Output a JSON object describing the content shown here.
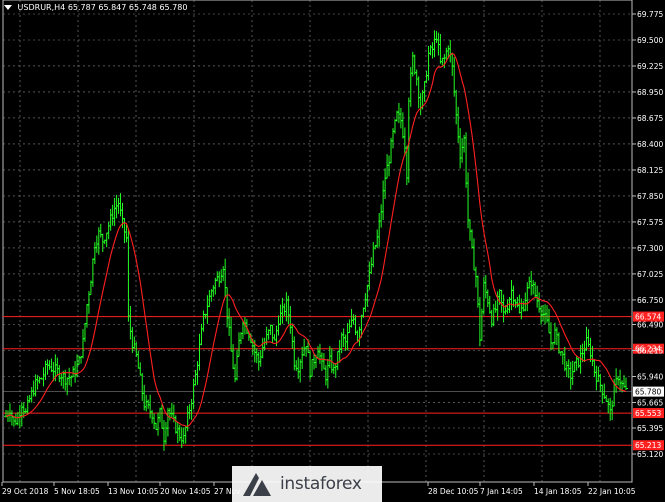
{
  "header": {
    "symbol": "USDRUR,H4",
    "open": "65.787",
    "high": "65.847",
    "low": "65.748",
    "close": "65.780"
  },
  "watermark": "instaforex",
  "colors": {
    "background": "#000000",
    "grid": "#8a8a8a",
    "bar": "#22ff22",
    "ma": "#ff2020",
    "level": "#ff2020",
    "axis_text": "#ffffff"
  },
  "chart_data": {
    "type": "ohlc",
    "grid": true,
    "ylim": [
      65.12,
      69.86
    ],
    "y_ticks": [
      "69.775",
      "69.500",
      "69.225",
      "68.950",
      "68.675",
      "68.400",
      "68.125",
      "67.850",
      "67.575",
      "67.300",
      "67.025",
      "66.750",
      "66.490",
      "66.215",
      "65.940",
      "65.665",
      "65.395",
      "65.120"
    ],
    "x_ticks": [
      "29 Oct 2018",
      "5 Nov 18:05",
      "13 Nov 10:05",
      "20 Nov 14:05",
      "27 Nov",
      "28 Dec 10:05",
      "7 Jan 14:05",
      "14 Jan 18:05",
      "22 Jan 10:05"
    ],
    "levels": [
      {
        "value": 66.574,
        "label": "66.574"
      },
      {
        "value": 66.234,
        "label": "66.234"
      },
      {
        "value": 65.553,
        "label": "65.553"
      },
      {
        "value": 65.213,
        "label": "65.213"
      }
    ],
    "current_price": {
      "value": 65.78,
      "label": "65.780"
    },
    "close_points": [
      [
        0,
        65.52
      ],
      [
        4,
        65.6
      ],
      [
        8,
        65.45
      ],
      [
        12,
        65.5
      ],
      [
        16,
        65.66
      ],
      [
        20,
        65.55
      ],
      [
        24,
        65.7
      ],
      [
        30,
        65.86
      ],
      [
        36,
        65.92
      ],
      [
        42,
        66.06
      ],
      [
        48,
        66.02
      ],
      [
        54,
        65.98
      ],
      [
        60,
        65.92
      ],
      [
        66,
        65.94
      ],
      [
        70,
        66.0
      ],
      [
        74,
        66.1
      ],
      [
        78,
        66.3
      ],
      [
        82,
        66.7
      ],
      [
        86,
        66.98
      ],
      [
        90,
        67.35
      ],
      [
        94,
        67.45
      ],
      [
        98,
        67.38
      ],
      [
        102,
        67.48
      ],
      [
        106,
        67.6
      ],
      [
        110,
        67.72
      ],
      [
        114,
        67.78
      ],
      [
        118,
        67.55
      ],
      [
        122,
        67.4
      ],
      [
        124,
        66.55
      ],
      [
        128,
        66.3
      ],
      [
        132,
        66.15
      ],
      [
        136,
        65.9
      ],
      [
        140,
        65.65
      ],
      [
        144,
        65.6
      ],
      [
        148,
        65.55
      ],
      [
        152,
        65.4
      ],
      [
        156,
        65.55
      ],
      [
        160,
        65.3
      ],
      [
        164,
        65.6
      ],
      [
        168,
        65.5
      ],
      [
        172,
        65.4
      ],
      [
        176,
        65.32
      ],
      [
        180,
        65.28
      ],
      [
        184,
        65.5
      ],
      [
        188,
        65.7
      ],
      [
        192,
        65.95
      ],
      [
        196,
        66.25
      ],
      [
        200,
        66.55
      ],
      [
        204,
        66.7
      ],
      [
        208,
        66.85
      ],
      [
        212,
        66.95
      ],
      [
        216,
        67.0
      ],
      [
        220,
        67.12
      ],
      [
        224,
        66.6
      ],
      [
        228,
        66.2
      ],
      [
        232,
        65.9
      ],
      [
        236,
        66.3
      ],
      [
        240,
        66.55
      ],
      [
        244,
        66.45
      ],
      [
        248,
        66.35
      ],
      [
        252,
        66.2
      ],
      [
        256,
        66.1
      ],
      [
        260,
        66.25
      ],
      [
        264,
        66.35
      ],
      [
        268,
        66.45
      ],
      [
        272,
        66.3
      ],
      [
        276,
        66.55
      ],
      [
        280,
        66.62
      ],
      [
        284,
        66.7
      ],
      [
        288,
        66.5
      ],
      [
        292,
        66.1
      ],
      [
        296,
        66.05
      ],
      [
        300,
        66.2
      ],
      [
        304,
        66.3
      ],
      [
        308,
        66.0
      ],
      [
        312,
        66.12
      ],
      [
        316,
        66.25
      ],
      [
        320,
        66.05
      ],
      [
        324,
        65.95
      ],
      [
        328,
        66.1
      ],
      [
        332,
        66.0
      ],
      [
        336,
        66.15
      ],
      [
        340,
        66.35
      ],
      [
        344,
        66.3
      ],
      [
        348,
        66.45
      ],
      [
        352,
        66.55
      ],
      [
        356,
        66.35
      ],
      [
        360,
        66.6
      ],
      [
        364,
        66.8
      ],
      [
        368,
        67.0
      ],
      [
        372,
        67.25
      ],
      [
        376,
        67.4
      ],
      [
        380,
        67.7
      ],
      [
        384,
        68.05
      ],
      [
        388,
        68.25
      ],
      [
        392,
        68.5
      ],
      [
        396,
        68.7
      ],
      [
        400,
        68.65
      ],
      [
        404,
        68.4
      ],
      [
        406,
        68.1
      ],
      [
        408,
        68.9
      ],
      [
        412,
        69.3
      ],
      [
        416,
        69.1
      ],
      [
        420,
        68.8
      ],
      [
        424,
        69.0
      ],
      [
        428,
        69.35
      ],
      [
        432,
        69.4
      ],
      [
        436,
        69.55
      ],
      [
        440,
        69.25
      ],
      [
        444,
        69.3
      ],
      [
        448,
        69.45
      ],
      [
        452,
        69.2
      ],
      [
        456,
        68.7
      ],
      [
        460,
        68.3
      ],
      [
        464,
        68.45
      ],
      [
        468,
        67.6
      ],
      [
        472,
        67.25
      ],
      [
        476,
        67.0
      ],
      [
        480,
        66.35
      ],
      [
        484,
        66.9
      ],
      [
        488,
        66.75
      ],
      [
        492,
        66.55
      ],
      [
        496,
        66.65
      ],
      [
        500,
        66.8
      ],
      [
        504,
        66.6
      ],
      [
        508,
        66.7
      ],
      [
        512,
        66.85
      ],
      [
        516,
        66.75
      ],
      [
        520,
        66.6
      ],
      [
        524,
        66.7
      ],
      [
        528,
        66.85
      ],
      [
        532,
        66.95
      ],
      [
        536,
        66.8
      ],
      [
        540,
        66.7
      ],
      [
        544,
        66.6
      ],
      [
        548,
        66.5
      ],
      [
        552,
        66.3
      ],
      [
        556,
        66.4
      ],
      [
        560,
        66.25
      ],
      [
        564,
        66.15
      ],
      [
        568,
        66.0
      ],
      [
        572,
        65.95
      ],
      [
        576,
        66.05
      ],
      [
        580,
        66.1
      ],
      [
        584,
        66.2
      ],
      [
        588,
        66.3
      ],
      [
        592,
        66.2
      ],
      [
        596,
        66.0
      ],
      [
        600,
        65.9
      ],
      [
        604,
        65.8
      ],
      [
        608,
        65.7
      ],
      [
        612,
        65.55
      ],
      [
        616,
        65.8
      ],
      [
        620,
        65.95
      ],
      [
        624,
        65.85
      ],
      [
        628,
        65.78
      ]
    ]
  }
}
